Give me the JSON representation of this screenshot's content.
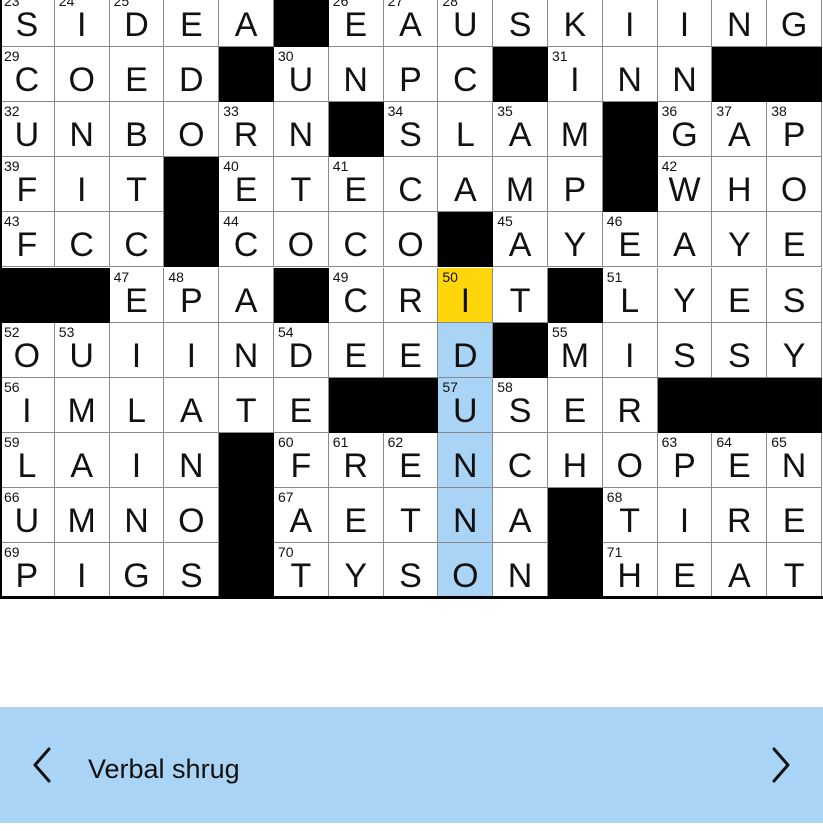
{
  "puzzle": {
    "rows": [
      "SIDEA#EAUSKIING",
      "COED#UNPC#INN##",
      "UNBORN#SLAM#GAP",
      "FIT#ETECAMP#WHO",
      "FCC#COCO#AYEAYE",
      "##EPA#CRIT#LYES",
      "OUIINDEED#MISSY",
      "IMLATE##USER###",
      "LAIN#FRENCHOPEN",
      "UMNO#AETNA#TIRE",
      "PIGS#TYSON#HEAT"
    ],
    "numbers": [
      [
        "23",
        "24",
        "25",
        "",
        "",
        "",
        "26",
        "27",
        "28",
        "",
        "",
        "",
        "",
        "",
        ""
      ],
      [
        "29",
        "",
        "",
        "",
        "",
        "30",
        "",
        "",
        "",
        "",
        "31",
        "",
        "",
        "",
        ""
      ],
      [
        "32",
        "",
        "",
        "",
        "33",
        "",
        "",
        "34",
        "",
        "35",
        "",
        "",
        "36",
        "37",
        "38"
      ],
      [
        "39",
        "",
        "",
        "",
        "40",
        "",
        "41",
        "",
        "",
        "",
        "",
        "",
        "42",
        "",
        ""
      ],
      [
        "43",
        "",
        "",
        "",
        "44",
        "",
        "",
        "",
        "",
        "45",
        "",
        "46",
        "",
        "",
        ""
      ],
      [
        "",
        "",
        "47",
        "48",
        "",
        "",
        "49",
        "",
        "50",
        "",
        "",
        "51",
        "",
        "",
        ""
      ],
      [
        "52",
        "53",
        "",
        "",
        "",
        "54",
        "",
        "",
        "",
        "",
        "55",
        "",
        "",
        "",
        ""
      ],
      [
        "56",
        "",
        "",
        "",
        "",
        "",
        "",
        "",
        "57",
        "58",
        "",
        "",
        "",
        "",
        ""
      ],
      [
        "59",
        "",
        "",
        "",
        "",
        "60",
        "61",
        "62",
        "",
        "",
        "",
        "",
        "63",
        "64",
        "65"
      ],
      [
        "66",
        "",
        "",
        "",
        "",
        "67",
        "",
        "",
        "",
        "",
        "",
        "68",
        "",
        "",
        ""
      ],
      [
        "69",
        "",
        "",
        "",
        "",
        "70",
        "",
        "",
        "",
        "",
        "",
        "71",
        "",
        "",
        ""
      ]
    ],
    "cursor": {
      "row": 5,
      "col": 8
    },
    "highlight_col": 8,
    "highlight_rows": [
      6,
      10
    ]
  },
  "clue": {
    "text": "Verbal shrug",
    "prev_icon": "chevron-left-icon",
    "next_icon": "chevron-right-icon"
  },
  "colors": {
    "highlight": "#a9d4f5",
    "cursor": "#ffd60a",
    "clue_bar": "#a9d4f5"
  }
}
